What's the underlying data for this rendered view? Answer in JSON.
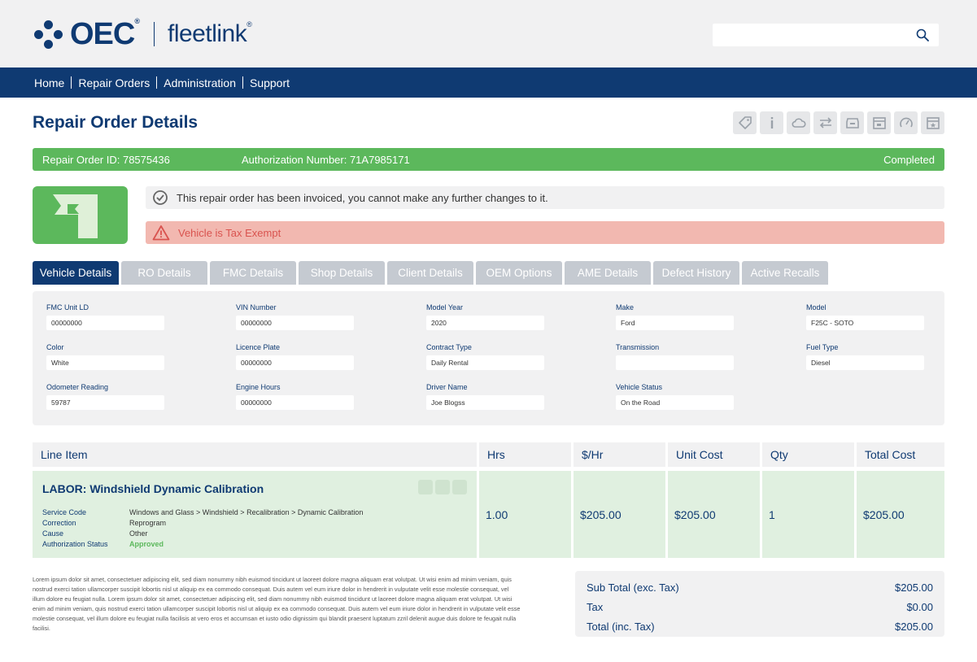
{
  "header": {
    "logo_primary": "OEC",
    "logo_secondary": "fleetlink",
    "search": {
      "value": "",
      "placeholder": ""
    }
  },
  "nav": [
    "Home",
    "Repair Orders",
    "Administration",
    "Support"
  ],
  "page": {
    "title": "Repair Order Details"
  },
  "toolbar": {
    "icons": [
      "tag-icon",
      "info-icon",
      "cloud-icon",
      "swap-icon",
      "archive-icon",
      "calendar-icon",
      "speedometer-icon",
      "calendar-star-icon"
    ]
  },
  "status_bar": {
    "repair_order_id": "Repair Order ID: 78575436",
    "authorization_number": "Authorization Number: 71A7985171",
    "status": "Completed",
    "color": "#5cb85c"
  },
  "notices": {
    "info": "This repair order has been invoiced, you cannot make any further changes to it.",
    "warning": "Vehicle is Tax Exempt"
  },
  "tabs": [
    "Vehicle Details",
    "RO Details",
    "FMC Details",
    "Shop Details",
    "Client Details",
    "OEM Options",
    "AME Details",
    "Defect History",
    "Active Recalls"
  ],
  "vehicle": {
    "fmc_unit": {
      "label": "FMC Unit LD",
      "value": "00000000"
    },
    "vin": {
      "label": "VIN Number",
      "value": "00000000"
    },
    "model_year": {
      "label": "Model Year",
      "value": "2020"
    },
    "make": {
      "label": "Make",
      "value": "Ford"
    },
    "model": {
      "label": "Model",
      "value": "F25C - SOTO"
    },
    "color": {
      "label": "Color",
      "value": "White"
    },
    "licence_plate": {
      "label": "Licence Plate",
      "value": "00000000"
    },
    "contract_type": {
      "label": "Contract Type",
      "value": "Daily Rental"
    },
    "transmission": {
      "label": "Transmission",
      "value": ""
    },
    "fuel_type": {
      "label": "Fuel Type",
      "value": "Diesel"
    },
    "odometer": {
      "label": "Odometer Reading",
      "value": "59787"
    },
    "engine_hours": {
      "label": "Engine Hours",
      "value": "00000000"
    },
    "driver_name": {
      "label": "Driver Name",
      "value": "Joe Blogss"
    },
    "vehicle_status": {
      "label": "Vehicle Status",
      "value": "On the Road"
    }
  },
  "line_items": {
    "headers": [
      "Line Item",
      "Hrs",
      "$/Hr",
      "Unit Cost",
      "Qty",
      "Total Cost"
    ],
    "rows": [
      {
        "title": "LABOR: Windshield Dynamic Calibration",
        "service_code_label": "Service Code",
        "service_code": "Windows and Glass > Windshield > Recalibration > Dynamic Calibration",
        "correction_label": "Correction",
        "correction": "Reprogram",
        "cause_label": "Cause",
        "cause": "Other",
        "auth_status_label": "Authorization Status",
        "auth_status": "Approved",
        "hrs": "1.00",
        "rate": "$205.00",
        "unit_cost": "$205.00",
        "qty": "1",
        "total_cost": "$205.00"
      }
    ]
  },
  "footer": {
    "lorem": "Lorem ipsum dolor sit amet, consectetuer adipiscing elit, sed diam nonummy nibh euismod tincidunt ut laoreet dolore magna aliquam erat volutpat. Ut wisi enim ad minim veniam, quis nostrud exerci tation ullamcorper suscipit lobortis nisl ut aliquip ex ea commodo consequat. Duis autem vel eum iriure dolor in hendrerit in vulputate velit esse molestie consequat, vel illum dolore eu feugiat nulla. Lorem ipsum dolor sit amet, consectetuer adipiscing elit, sed diam nonummy nibh euismod tincidunt ut laoreet dolore magna aliquam erat volutpat. Ut wisi enim ad minim veniam, quis nostrud exerci tation ullamcorper suscipit lobortis nisl ut aliquip ex ea commodo consequat. Duis autem vel eum iriure dolor in hendrerit in vulputate velit esse molestie consequat, vel illum dolore eu feugiat nulla facilisis at vero eros et accumsan et iusto odio dignissim qui blandit praesent luptatum zzril delenit augue duis dolore te feugait nulla facilisi."
  },
  "totals": {
    "subtotal_label": "Sub Total (exc. Tax)",
    "subtotal": "$205.00",
    "tax_label": "Tax",
    "tax": "$0.00",
    "total_label": "Total (inc. Tax)",
    "total": "$205.00"
  },
  "colors": {
    "brand_navy": "#0f3a72",
    "success_green": "#5cb85c",
    "warning_pink": "#f2b8b0",
    "warning_red": "#d9534f"
  }
}
